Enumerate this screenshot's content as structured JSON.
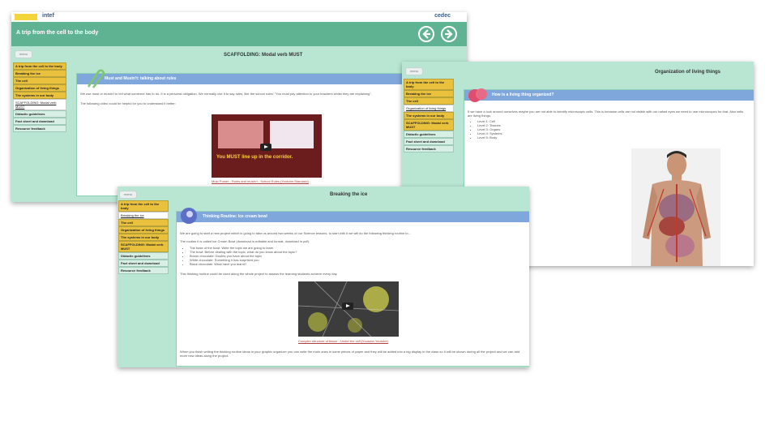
{
  "app": {
    "brand_left": "intef",
    "brand_right": "cedec"
  },
  "course_title": "A trip from the cell to the body",
  "menu_label": "menu",
  "nav": [
    {
      "label": "A trip from the cell to the body"
    },
    {
      "label": "Breaking the ice"
    },
    {
      "label": "The cell"
    },
    {
      "label": "Organization of living things"
    },
    {
      "label": "The systems in our body"
    },
    {
      "label": "SCAFFOLDING: Modal verb MUST"
    },
    {
      "label": "Didactic guidelines"
    },
    {
      "label": "Fact sheet and download"
    },
    {
      "label": "Resource feedback"
    }
  ],
  "page1": {
    "title": "SCAFFOLDING: Modal verb MUST",
    "panel_title": "Must and Mustn't: talking about rules",
    "p1": "We use must or mustn't to tell what someone has to do. It is a personal obligation. We normally use it to say rules, like the school rules: \"You must pay attention to your teachers whilst they are explaining\".",
    "p2": "The following video could be helpful for you to understand it better:",
    "video_text": "You MUST line up in the corridor.",
    "caption": "Must Poster - Rules and mustn't - School Rules (Youtube-Standard)"
  },
  "page2": {
    "title": "Breaking the ice",
    "panel_title": "Thinking Routine: Ice cream bowl",
    "p1": "We are going to start a new project which is going to take us around two weeks of our Science lessons, to start with it we will do the following thinking routine to...",
    "p2": "The routine it is called Ice Cream Bowl (download in editable and format, download in pdf).",
    "bullets": [
      "The base of the bowl: Write the topic we are going to learn",
      "The bowl: Before dealing with the topic, what do you know about the topic?",
      "Brown chocolate: Doubts you have about the topic",
      "White chocolate: Something it has surprised you",
      "Black chocolate: What have you learnt?"
    ],
    "p3": "This thinking routine could be used along the whole project to assess the learning students achieve every day.",
    "caption": "Complex structure of tissue - Under the cell (Youtube-Youtube)",
    "p4": "When you finish writing the thinking routine ideas in your graphic organizer you can write the main ones in some pieces of paper and they will be added into a big display in the class so it will be shown during all the project and we can add more new ideas along the project."
  },
  "page3": {
    "title": "Organization of living things",
    "panel_title": "How is a living thing organized?",
    "p1": "If we have a look around ourselves maybe you are not able to identify microscopic cells. This is because cells are not visible with our naked eyes we need to use microscopes for that. Also cells are living things:",
    "levels": [
      "Level 1: Cell",
      "Level 2: Tissues",
      "Level 3: Organs",
      "Level 4: Systems",
      "Level 5: Body"
    ]
  },
  "colors": {
    "header_green": "#5fb393",
    "page_mint": "#b9e6d3",
    "nav_yellow": "#e9c13d",
    "panel_blue": "#7fa7db",
    "link_red": "#b04040"
  }
}
